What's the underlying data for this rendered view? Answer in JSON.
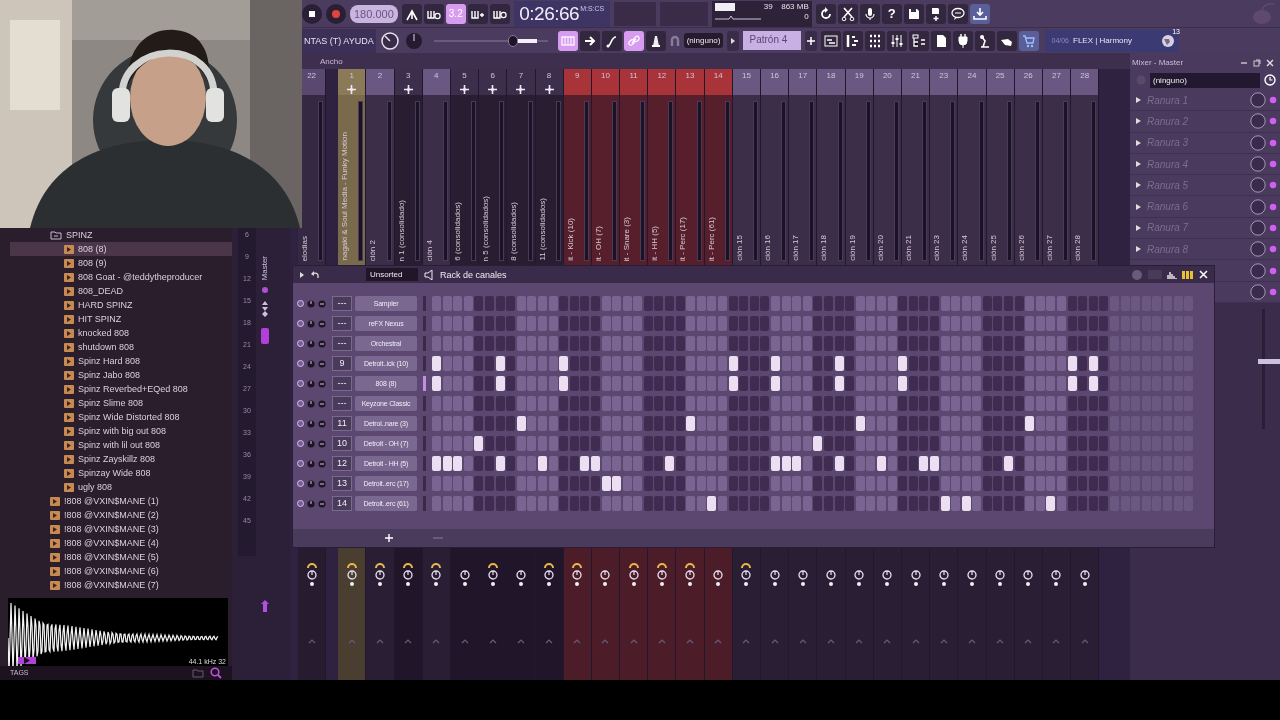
{
  "toolbar": {
    "recording": false,
    "tempo": "180.000",
    "toggles_1": [
      {
        "kind": "wing",
        "on": false
      },
      {
        "kind": "wait",
        "on": false
      },
      {
        "kind": "snap",
        "label": "3.2",
        "on": true
      },
      {
        "kind": "overdub",
        "on": false
      },
      {
        "kind": "loop",
        "on": false
      }
    ],
    "time": "0:26:66",
    "time_format": "M:S:CS",
    "cpu": "39",
    "memory": "863 MB",
    "polyphony": "0",
    "help": "?",
    "menu": "NTAS (T) AYUDA",
    "volume_slider": {
      "level": 0.7
    },
    "toggles_2": [
      {
        "kind": "keys",
        "on": true
      },
      {
        "kind": "arrow",
        "on": false
      },
      {
        "kind": "curve",
        "on": false
      },
      {
        "kind": "link",
        "on": true
      },
      {
        "kind": "bell",
        "on": false
      }
    ],
    "pattern_picker": "(ninguno)",
    "pattern": "Patrón 4",
    "news_counter": "04/06",
    "news_title": "FLEX | Harmony",
    "news_badge": "13"
  },
  "browser": {
    "items": [
      {
        "label": "SPINZ",
        "kind": "folder",
        "expanded": true,
        "selected": false,
        "children": [
          {
            "label": "808 (8)",
            "kind": "file",
            "selected": true
          },
          {
            "label": "808 (9)",
            "kind": "file",
            "selected": false
          },
          {
            "label": "808 Goat - @teddytheproducer",
            "kind": "file",
            "selected": false
          },
          {
            "label": "808_DEAD",
            "kind": "file",
            "selected": false
          },
          {
            "label": "HARD SPINZ",
            "kind": "file",
            "selected": false
          },
          {
            "label": "HIT SPINZ",
            "kind": "file",
            "selected": false
          },
          {
            "label": "knocked 808",
            "kind": "file",
            "selected": false
          },
          {
            "label": "shutdown 808",
            "kind": "file",
            "selected": false
          },
          {
            "label": "Spinz Hard 808",
            "kind": "file",
            "selected": false
          },
          {
            "label": "Spinz Jabo 808",
            "kind": "file",
            "selected": false
          },
          {
            "label": "Spinz Reverbed+EQed 808",
            "kind": "file",
            "selected": false
          },
          {
            "label": "Spinz Slime 808",
            "kind": "file",
            "selected": false
          },
          {
            "label": "Spinz Wide Distorted 808",
            "kind": "file",
            "selected": false
          },
          {
            "label": "Spinz with big out 808",
            "kind": "file",
            "selected": false
          },
          {
            "label": "Spinz with lil out 808",
            "kind": "file",
            "selected": false
          },
          {
            "label": "Spinz Zayskillz 808",
            "kind": "file",
            "selected": false
          },
          {
            "label": "Spinzay Wide 808",
            "kind": "file",
            "selected": false
          },
          {
            "label": "ugly 808",
            "kind": "file",
            "selected": false
          }
        ]
      },
      {
        "label": "!808 @VXIN$MANE (1)",
        "kind": "file",
        "selected": false
      },
      {
        "label": "!808 @VXIN$MANE (2)",
        "kind": "file",
        "selected": false
      },
      {
        "label": "!808 @VXIN$MANE (3)",
        "kind": "file",
        "selected": false
      },
      {
        "label": "!808 @VXIN$MANE (4)",
        "kind": "file",
        "selected": false
      },
      {
        "label": "!808 @VXIN$MANE (5)",
        "kind": "file",
        "selected": false
      },
      {
        "label": "!808 @VXIN$MANE (6)",
        "kind": "file",
        "selected": false
      },
      {
        "label": "!808 @VXIN$MANE (7)",
        "kind": "file",
        "selected": false
      }
    ],
    "sample_info": "44.1 kHz 32",
    "tags_label": "TAGS"
  },
  "insert": {
    "label": "Master",
    "scale": [
      "6",
      "9",
      "12",
      "15",
      "18",
      "21",
      "24",
      "27",
      "30",
      "33",
      "36",
      "39",
      "42",
      "45"
    ]
  },
  "mixer": {
    "width_label": "Ancho",
    "tracks": [
      {
        "number": "22",
        "name": "elodias",
        "color": "#5a4870",
        "plus": false,
        "routed": true,
        "selected": false
      },
      {
        "number": "1",
        "name": "nagaki & Soul Media - Funky Motion",
        "color": "#8a7a58",
        "plus": true,
        "routed": true,
        "selected": true
      },
      {
        "number": "2",
        "name": "ción 2",
        "color": "#6a5882",
        "plus": false,
        "routed": true,
        "selected": false
      },
      {
        "number": "3",
        "name": "n 1 (consolidado)",
        "color": "#3d2e4b",
        "plus": true,
        "routed": true,
        "selected": false
      },
      {
        "number": "4",
        "name": "ción 4",
        "color": "#6a5882",
        "plus": false,
        "routed": true,
        "selected": false
      },
      {
        "number": "5",
        "name": "6 (consolidados)",
        "color": "#3d2e4b",
        "plus": true,
        "routed": false,
        "selected": false
      },
      {
        "number": "6",
        "name": "n 5 (consolidados)",
        "color": "#3d2e4b",
        "plus": true,
        "routed": true,
        "selected": false
      },
      {
        "number": "7",
        "name": "8 (consolidados)",
        "color": "#3d2e4b",
        "plus": true,
        "routed": false,
        "selected": false
      },
      {
        "number": "8",
        "name": "11 (consolidados)",
        "color": "#3d2e4b",
        "plus": true,
        "routed": true,
        "selected": false
      },
      {
        "number": "9",
        "name": "it - Kick (10)",
        "color": "#a8343a",
        "plus": false,
        "routed": true,
        "selected": false
      },
      {
        "number": "10",
        "name": "it - OH (7)",
        "color": "#a8343a",
        "plus": false,
        "routed": false,
        "selected": false
      },
      {
        "number": "11",
        "name": "it - Snare (3)",
        "color": "#a8343a",
        "plus": false,
        "routed": true,
        "selected": false
      },
      {
        "number": "12",
        "name": "it - HH (5)",
        "color": "#a8343a",
        "plus": false,
        "routed": true,
        "selected": false
      },
      {
        "number": "13",
        "name": "it - Perc (17)",
        "color": "#a8343a",
        "plus": false,
        "routed": true,
        "selected": false
      },
      {
        "number": "14",
        "name": "it - Perc (61)",
        "color": "#a8343a",
        "plus": false,
        "routed": false,
        "selected": false
      },
      {
        "number": "15",
        "name": "ción 15",
        "color": "#6a5882",
        "plus": false,
        "routed": true,
        "selected": false
      },
      {
        "number": "16",
        "name": "ción 16",
        "color": "#6a5882",
        "plus": false,
        "routed": false,
        "selected": false
      },
      {
        "number": "17",
        "name": "ción 17",
        "color": "#6a5882",
        "plus": false,
        "routed": false,
        "selected": false
      },
      {
        "number": "18",
        "name": "ción 18",
        "color": "#6a5882",
        "plus": false,
        "routed": false,
        "selected": false
      },
      {
        "number": "19",
        "name": "ción 19",
        "color": "#6a5882",
        "plus": false,
        "routed": false,
        "selected": false
      },
      {
        "number": "20",
        "name": "ción 20",
        "color": "#6a5882",
        "plus": false,
        "routed": false,
        "selected": false
      },
      {
        "number": "21",
        "name": "ción 21",
        "color": "#6a5882",
        "plus": false,
        "routed": false,
        "selected": false
      },
      {
        "number": "23",
        "name": "ción 23",
        "color": "#6a5882",
        "plus": false,
        "routed": false,
        "selected": false
      },
      {
        "number": "24",
        "name": "ción 24",
        "color": "#6a5882",
        "plus": false,
        "routed": false,
        "selected": false
      },
      {
        "number": "25",
        "name": "ción 25",
        "color": "#6a5882",
        "plus": false,
        "routed": false,
        "selected": false
      },
      {
        "number": "26",
        "name": "ción 26",
        "color": "#6a5882",
        "plus": false,
        "routed": false,
        "selected": false
      },
      {
        "number": "27",
        "name": "ción 27",
        "color": "#6a5882",
        "plus": false,
        "routed": false,
        "selected": false
      },
      {
        "number": "28",
        "name": "ción 28",
        "color": "#6a5882",
        "plus": false,
        "routed": false,
        "selected": false
      }
    ]
  },
  "mixer_panel": {
    "title": "Mixer - Master",
    "preset": "(ninguno)",
    "slots": [
      {
        "label": "Ranura 1",
        "active": true
      },
      {
        "label": "Ranura 2",
        "active": true
      },
      {
        "label": "Ranura 3",
        "active": true
      },
      {
        "label": "Ranura 4",
        "active": true
      },
      {
        "label": "Ranura 5",
        "active": true
      },
      {
        "label": "Ranura 6",
        "active": true
      },
      {
        "label": "Ranura 7",
        "active": true
      },
      {
        "label": "Ranura 8",
        "active": true
      },
      {
        "active": true
      },
      {
        "active": true
      }
    ]
  },
  "channel_rack": {
    "title": "Rack de canales",
    "filter": "Unsorted",
    "extra_steps_shown": true,
    "channels": [
      {
        "name": "Sampler",
        "track": "---",
        "selected": false,
        "steps": [
          false,
          false,
          false,
          false,
          false,
          false,
          false,
          false,
          false,
          false,
          false,
          false,
          false,
          false,
          false,
          false,
          false,
          false,
          false,
          false,
          false,
          false,
          false,
          false,
          false,
          false,
          false,
          false,
          false,
          false,
          false,
          false,
          false,
          false,
          false,
          false,
          false,
          false,
          false,
          false,
          false,
          false,
          false,
          false,
          false,
          false,
          false,
          false,
          false,
          false,
          false,
          false,
          false,
          false,
          false,
          false,
          false,
          false,
          false,
          false,
          false,
          false,
          false,
          false
        ]
      },
      {
        "name": "reFX Nexus",
        "track": "---",
        "selected": false,
        "steps": [
          false,
          false,
          false,
          false,
          false,
          false,
          false,
          false,
          false,
          false,
          false,
          false,
          false,
          false,
          false,
          false,
          false,
          false,
          false,
          false,
          false,
          false,
          false,
          false,
          false,
          false,
          false,
          false,
          false,
          false,
          false,
          false,
          false,
          false,
          false,
          false,
          false,
          false,
          false,
          false,
          false,
          false,
          false,
          false,
          false,
          false,
          false,
          false,
          false,
          false,
          false,
          false,
          false,
          false,
          false,
          false,
          false,
          false,
          false,
          false,
          false,
          false,
          false,
          false
        ]
      },
      {
        "name": "Orchestral",
        "track": "---",
        "selected": false,
        "steps": [
          false,
          false,
          false,
          false,
          false,
          false,
          false,
          false,
          false,
          false,
          false,
          false,
          false,
          false,
          false,
          false,
          false,
          false,
          false,
          false,
          false,
          false,
          false,
          false,
          false,
          false,
          false,
          false,
          false,
          false,
          false,
          false,
          false,
          false,
          false,
          false,
          false,
          false,
          false,
          false,
          false,
          false,
          false,
          false,
          false,
          false,
          false,
          false,
          false,
          false,
          false,
          false,
          false,
          false,
          false,
          false,
          false,
          false,
          false,
          false,
          false,
          false,
          false,
          false
        ]
      },
      {
        "name": "Detroit..ick (10)",
        "track": "9",
        "selected": false,
        "steps": [
          true,
          false,
          false,
          false,
          false,
          false,
          true,
          false,
          false,
          false,
          false,
          false,
          true,
          false,
          false,
          false,
          false,
          false,
          false,
          false,
          false,
          false,
          false,
          false,
          false,
          false,
          false,
          false,
          true,
          false,
          false,
          false,
          true,
          false,
          false,
          false,
          false,
          false,
          true,
          false,
          false,
          false,
          false,
          false,
          true,
          false,
          false,
          false,
          false,
          false,
          false,
          false,
          false,
          false,
          false,
          false,
          false,
          false,
          false,
          false,
          true,
          false,
          true,
          false
        ]
      },
      {
        "name": "808 (8)",
        "track": "---",
        "selected": true,
        "steps": [
          true,
          false,
          false,
          false,
          false,
          false,
          true,
          false,
          false,
          false,
          false,
          false,
          true,
          false,
          false,
          false,
          false,
          false,
          false,
          false,
          false,
          false,
          false,
          false,
          false,
          false,
          false,
          false,
          true,
          false,
          false,
          false,
          true,
          false,
          false,
          false,
          false,
          false,
          true,
          false,
          false,
          false,
          false,
          false,
          true,
          false,
          false,
          false,
          false,
          false,
          false,
          false,
          false,
          false,
          false,
          false,
          false,
          false,
          false,
          false,
          true,
          false,
          true,
          false
        ]
      },
      {
        "name": "Keyzone Classic",
        "track": "---",
        "selected": false,
        "steps": [
          false,
          false,
          false,
          false,
          false,
          false,
          false,
          false,
          false,
          false,
          false,
          false,
          false,
          false,
          false,
          false,
          false,
          false,
          false,
          false,
          false,
          false,
          false,
          false,
          false,
          false,
          false,
          false,
          false,
          false,
          false,
          false,
          false,
          false,
          false,
          false,
          false,
          false,
          false,
          false,
          false,
          false,
          false,
          false,
          false,
          false,
          false,
          false,
          false,
          false,
          false,
          false,
          false,
          false,
          false,
          false,
          false,
          false,
          false,
          false,
          false,
          false,
          false,
          false
        ]
      },
      {
        "name": "Detroi..nare (3)",
        "track": "11",
        "selected": false,
        "steps": [
          false,
          false,
          false,
          false,
          false,
          false,
          false,
          false,
          true,
          false,
          false,
          false,
          false,
          false,
          false,
          false,
          false,
          false,
          false,
          false,
          false,
          false,
          false,
          false,
          true,
          false,
          false,
          false,
          false,
          false,
          false,
          false,
          false,
          false,
          false,
          false,
          false,
          false,
          false,
          false,
          true,
          false,
          false,
          false,
          false,
          false,
          false,
          false,
          false,
          false,
          false,
          false,
          false,
          false,
          false,
          false,
          true,
          false,
          false,
          false,
          false,
          false,
          false,
          false
        ]
      },
      {
        "name": "Detroit - OH (7)",
        "track": "10",
        "selected": false,
        "steps": [
          false,
          false,
          false,
          false,
          true,
          false,
          false,
          false,
          false,
          false,
          false,
          false,
          false,
          false,
          false,
          false,
          false,
          false,
          false,
          false,
          false,
          false,
          false,
          false,
          false,
          false,
          false,
          false,
          false,
          false,
          false,
          false,
          false,
          false,
          false,
          false,
          true,
          false,
          false,
          false,
          false,
          false,
          false,
          false,
          false,
          false,
          false,
          false,
          false,
          false,
          false,
          false,
          false,
          false,
          false,
          false,
          false,
          false,
          false,
          false,
          false,
          false,
          false,
          false
        ]
      },
      {
        "name": "Detroit - HH (5)",
        "track": "12",
        "selected": false,
        "steps": [
          true,
          true,
          true,
          false,
          false,
          false,
          true,
          false,
          false,
          false,
          true,
          false,
          false,
          false,
          true,
          true,
          false,
          false,
          false,
          false,
          false,
          false,
          true,
          false,
          false,
          false,
          false,
          false,
          false,
          false,
          false,
          false,
          true,
          true,
          true,
          false,
          false,
          false,
          true,
          false,
          false,
          false,
          true,
          false,
          false,
          false,
          true,
          true,
          false,
          false,
          false,
          false,
          false,
          false,
          true,
          false,
          false,
          false,
          false,
          false,
          false,
          false,
          false,
          false
        ]
      },
      {
        "name": "Detroit..erc (17)",
        "track": "13",
        "selected": false,
        "steps": [
          false,
          false,
          false,
          false,
          false,
          false,
          false,
          false,
          false,
          false,
          false,
          false,
          false,
          false,
          false,
          false,
          true,
          true,
          false,
          false,
          false,
          false,
          false,
          false,
          false,
          false,
          false,
          false,
          false,
          false,
          false,
          false,
          false,
          false,
          false,
          false,
          false,
          false,
          false,
          false,
          false,
          false,
          false,
          false,
          false,
          false,
          false,
          false,
          false,
          false,
          false,
          false,
          false,
          false,
          false,
          false,
          false,
          false,
          false,
          false,
          false,
          false,
          false,
          false
        ]
      },
      {
        "name": "Detroit..erc (61)",
        "track": "14",
        "selected": false,
        "steps": [
          false,
          false,
          false,
          false,
          false,
          false,
          false,
          false,
          false,
          false,
          false,
          false,
          false,
          false,
          false,
          false,
          false,
          false,
          false,
          false,
          false,
          false,
          false,
          false,
          false,
          false,
          true,
          false,
          false,
          false,
          false,
          false,
          false,
          false,
          false,
          false,
          false,
          false,
          false,
          false,
          false,
          false,
          false,
          false,
          false,
          false,
          false,
          false,
          true,
          false,
          true,
          false,
          false,
          false,
          false,
          false,
          false,
          false,
          true,
          false,
          false,
          false,
          false,
          false
        ]
      }
    ]
  }
}
